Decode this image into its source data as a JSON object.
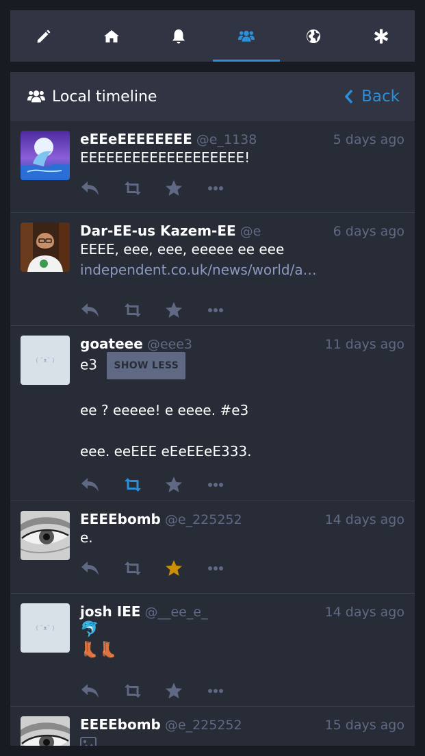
{
  "nav": {
    "tabs": [
      {
        "icon": "pencil-icon",
        "active": false
      },
      {
        "icon": "home-icon",
        "active": false
      },
      {
        "icon": "bell-icon",
        "active": false
      },
      {
        "icon": "users-icon",
        "active": true
      },
      {
        "icon": "globe-icon",
        "active": false
      },
      {
        "icon": "asterisk-icon",
        "active": false
      }
    ]
  },
  "column": {
    "title": "Local timeline",
    "back_label": "Back"
  },
  "colors": {
    "accent": "#2b90d9",
    "muted": "#606984",
    "favourited": "#ca8f04"
  },
  "statuses": [
    {
      "display_name": "eEEeEEEEEEEE",
      "acct": "@e_1138",
      "time": "5 days ago",
      "content": "EEEEEEEEEEEEEEEEEEE!"
    },
    {
      "display_name": "Dar-EE-us Kazem-EE",
      "acct": "@e",
      "time": "6 days ago",
      "content": "EEEE, eee, eee, eeeee ee eee",
      "link": "independent.co.uk/news/world/a…"
    },
    {
      "display_name": "goateee",
      "acct": "@eee3",
      "time": "11 days ago",
      "spoiler": "e3",
      "show_less_label": "SHOW LESS",
      "paragraph_1": "ee ? eeeee! e eeee. #e3",
      "paragraph_2": "eee. eeEEE eEeEEeE333.",
      "avatar_text": "( ˘ᴥ˘ )"
    },
    {
      "display_name": "EEEEbomb",
      "acct": "@e_225252",
      "time": "14 days ago",
      "content": "e."
    },
    {
      "display_name": "josh IEE",
      "acct": "@__ee_e_",
      "time": "14 days ago",
      "emoji_1": "🐬",
      "emoji_2": "👢👢",
      "avatar_text": "( ˘ᴥ˘ )"
    },
    {
      "display_name": "EEEEbomb",
      "acct": "@e_225252",
      "time": "15 days ago"
    }
  ]
}
